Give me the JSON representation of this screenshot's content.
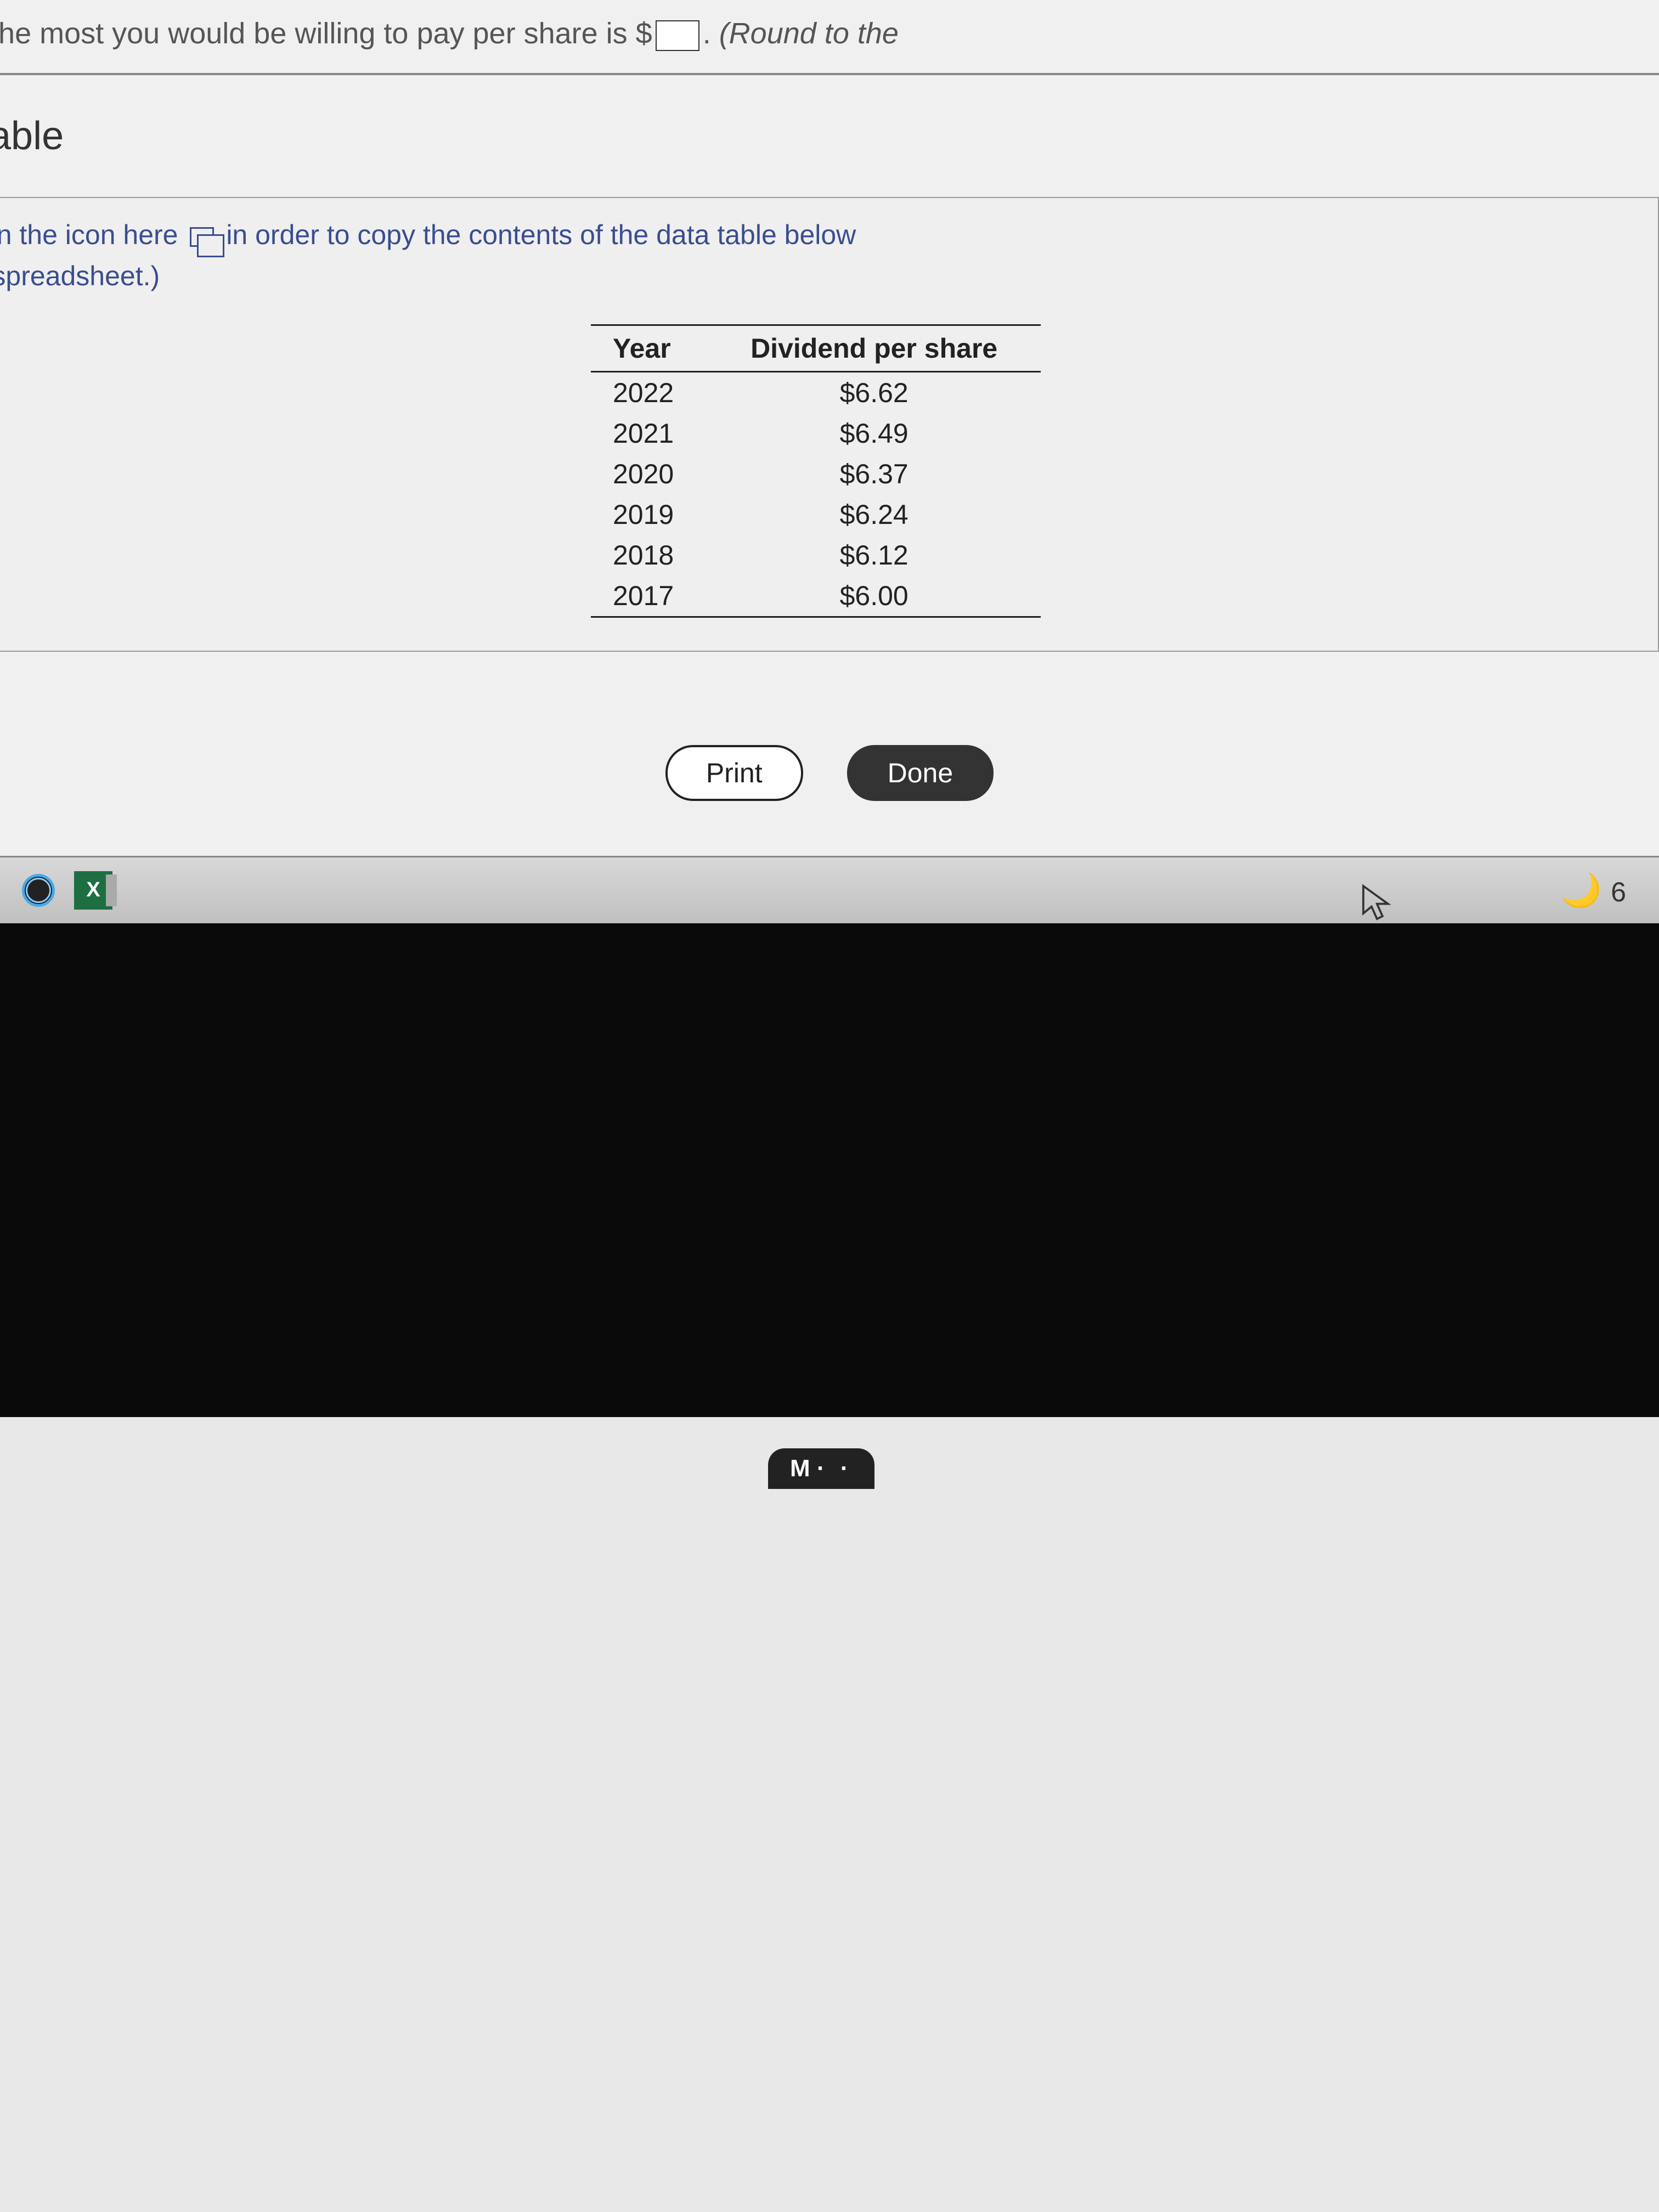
{
  "top_question": {
    "prefix": "nts, the most you would be willing to pay per share is $",
    "suffix_round": "(Round to the"
  },
  "section_title": "table",
  "instruction": {
    "line1_prefix": "ck on the icon here",
    "line1_suffix": "in order to copy the contents of the data table below",
    "line2": "o a spreadsheet.)"
  },
  "table": {
    "headers": {
      "year": "Year",
      "dividend": "Dividend per share"
    },
    "rows": [
      {
        "year": "2022",
        "dividend": "$6.62"
      },
      {
        "year": "2021",
        "dividend": "$6.49"
      },
      {
        "year": "2020",
        "dividend": "$6.37"
      },
      {
        "year": "2019",
        "dividend": "$6.24"
      },
      {
        "year": "2018",
        "dividend": "$6.12"
      },
      {
        "year": "2017",
        "dividend": "$6.00"
      }
    ]
  },
  "buttons": {
    "print": "Print",
    "done": "Done"
  },
  "taskbar": {
    "excel_label": "X",
    "time_fragment": "6"
  },
  "media_badge": "M"
}
